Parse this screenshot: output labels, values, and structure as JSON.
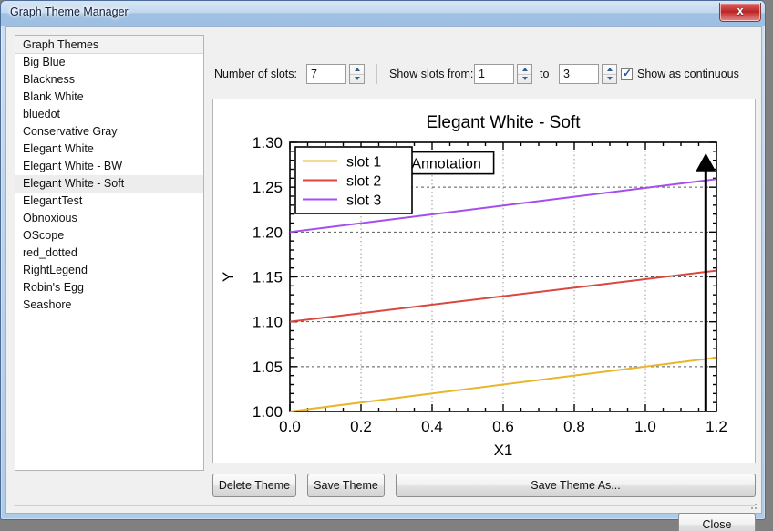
{
  "window": {
    "title": "Graph Theme Manager",
    "close_icon": "window-close-x"
  },
  "theme_list": {
    "header": "Graph Themes",
    "selected": "Elegant White - Soft",
    "items": [
      "Big Blue",
      "Blackness",
      "Blank White",
      "bluedot",
      "Conservative Gray",
      "Elegant White",
      "Elegant White - BW",
      "Elegant White - Soft",
      "ElegantTest",
      "Obnoxious",
      "OScope",
      "red_dotted",
      "RightLegend",
      "Robin's Egg",
      "Seashore"
    ]
  },
  "toolbar": {
    "slots_label": "Number of slots:",
    "slots_value": "7",
    "show_from_label": "Show slots from:",
    "from_value": "1",
    "to_label": "to",
    "to_value": "3",
    "continuous_label": "Show as continuous",
    "continuous_checked": true,
    "check_glyph": "✓"
  },
  "buttons": {
    "delete_theme": "Delete Theme",
    "save_theme": "Save Theme",
    "save_theme_as": "Save Theme As...",
    "close": "Close"
  },
  "chart_data": {
    "type": "line",
    "title": "Elegant White - Soft",
    "xlabel": "X1",
    "ylabel": "Y",
    "xlim": [
      0.0,
      1.2
    ],
    "ylim": [
      1.0,
      1.3
    ],
    "xticks": [
      "0.0",
      "0.2",
      "0.4",
      "0.6",
      "0.8",
      "1.0",
      "1.2"
    ],
    "xtick_values": [
      0.0,
      0.2,
      0.4,
      0.6,
      0.8,
      1.0,
      1.2
    ],
    "yticks": [
      "1.00",
      "1.05",
      "1.10",
      "1.15",
      "1.20",
      "1.25",
      "1.30"
    ],
    "ytick_values": [
      1.0,
      1.05,
      1.1,
      1.15,
      1.2,
      1.25,
      1.3
    ],
    "grid": true,
    "grid_style": "dotted",
    "legend_position": "top-left",
    "background": "#ffffff",
    "series": [
      {
        "name": "slot 1",
        "color": "#e8b62c",
        "x": [
          0.0,
          1.2
        ],
        "values": [
          1.0,
          1.06
        ]
      },
      {
        "name": "slot 2",
        "color": "#d9473f",
        "x": [
          0.0,
          1.2
        ],
        "values": [
          1.1,
          1.157
        ]
      },
      {
        "name": "slot 3",
        "color": "#a44ef0",
        "x": [
          0.0,
          1.2
        ],
        "values": [
          1.2,
          1.259
        ]
      }
    ],
    "annotations": [
      {
        "type": "label-box",
        "text": "Annotation",
        "x": 0.44,
        "y": 1.277
      },
      {
        "type": "arrow",
        "x": 1.17,
        "y_start": 1.0,
        "y_end": 1.288,
        "color": "#000000"
      }
    ]
  }
}
